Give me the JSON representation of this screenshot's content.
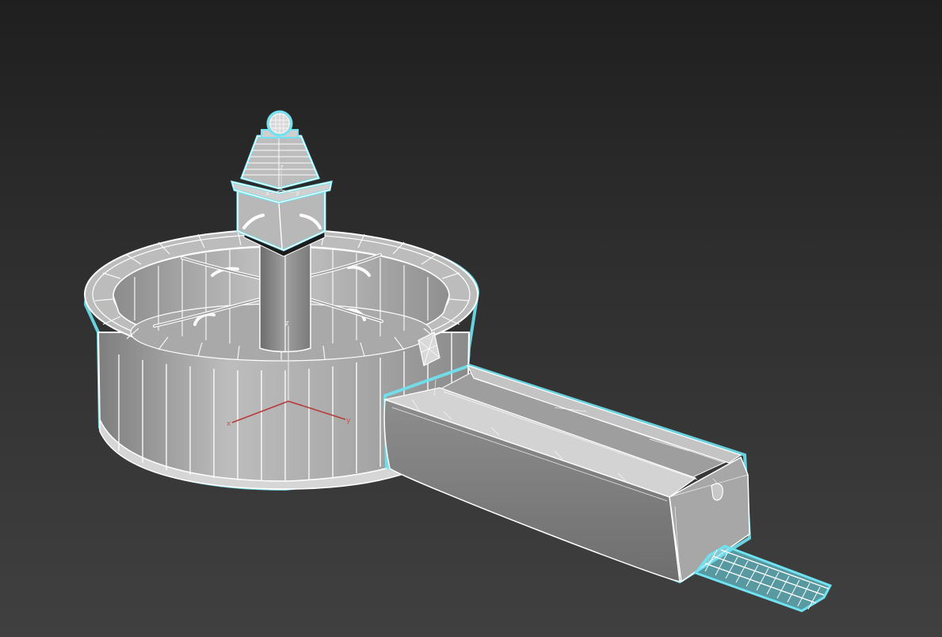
{
  "viewport": {
    "background_top": "#1f1f1f",
    "background_bottom": "#404040"
  },
  "model": {
    "selection_color": "#6fe3f2",
    "wire_color": "#ffffff",
    "surface_light": "#b3b3b3",
    "surface_mid": "#9a9a9a",
    "surface_dark": "#7c7c7c"
  },
  "gizmo_main": {
    "x_label": "x",
    "y_label": "y",
    "z_label": "z",
    "color": "#b83a3a"
  },
  "gizmo_small": {
    "x_label": "x",
    "y_label": "y",
    "z_label": "z"
  }
}
